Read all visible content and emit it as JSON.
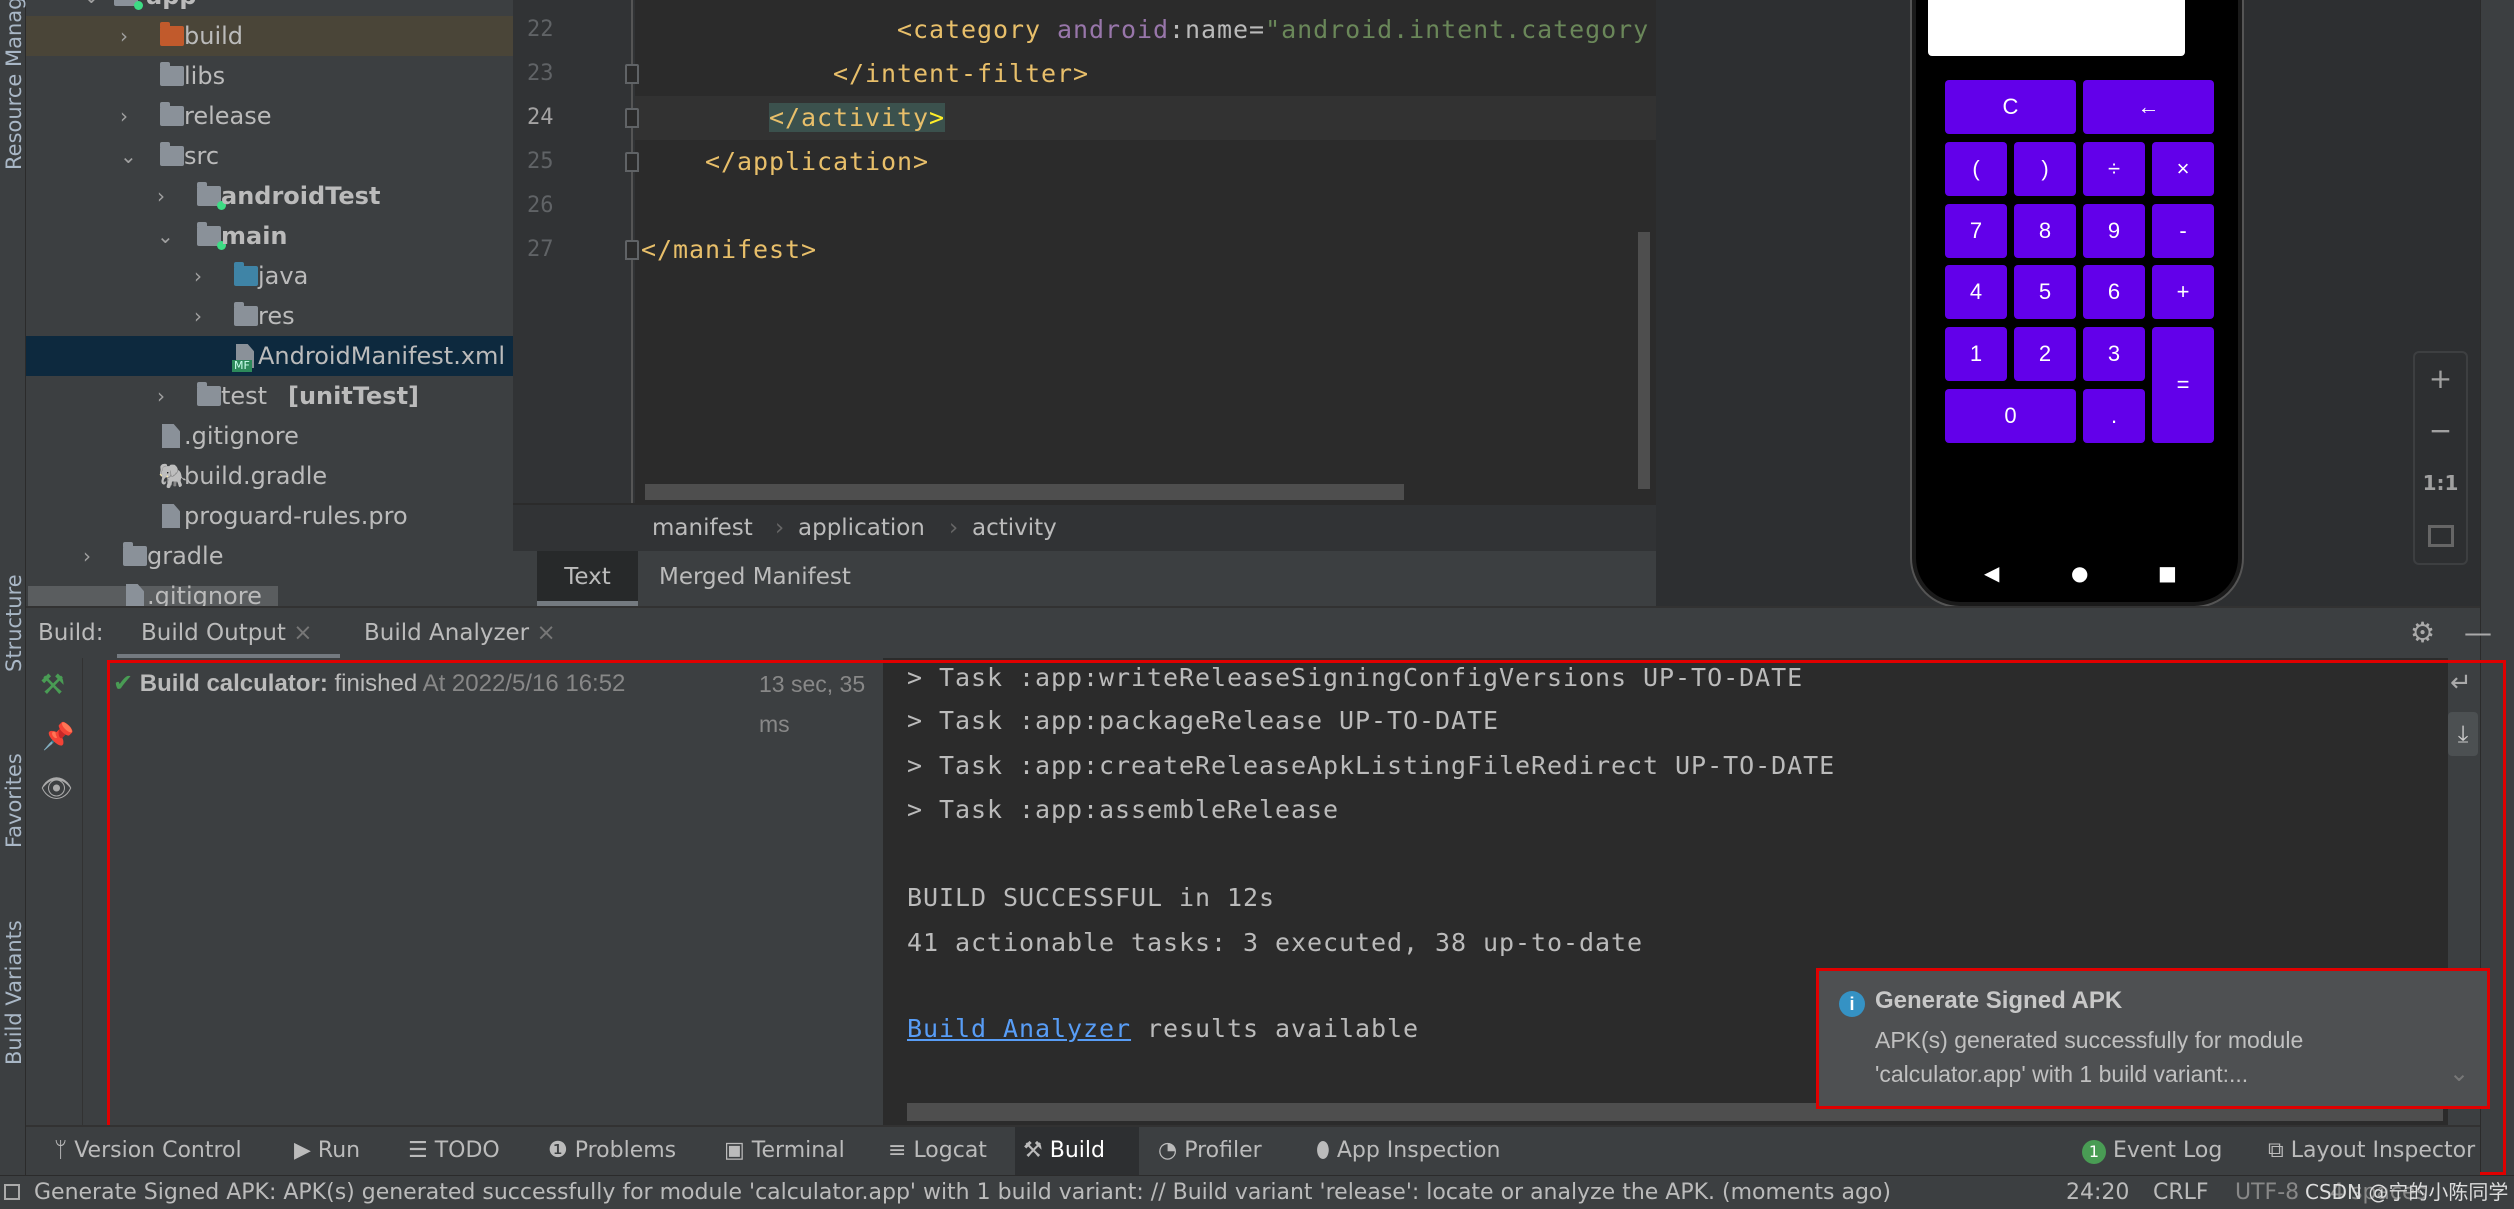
{
  "left_strip": {
    "resource_manager": "Resource Manager",
    "structure": "Structure",
    "favorites": "Favorites",
    "build_variants": "Build Variants"
  },
  "project_tree": {
    "items": [
      {
        "label": "app"
      },
      {
        "label": "build"
      },
      {
        "label": "libs"
      },
      {
        "label": "release"
      },
      {
        "label": "src"
      },
      {
        "label": "androidTest"
      },
      {
        "label": "main"
      },
      {
        "label": "java"
      },
      {
        "label": "res"
      },
      {
        "label": "AndroidManifest.xml",
        "badge": "MF"
      },
      {
        "label": "test",
        "suffix": "[unitTest]"
      },
      {
        "label": ".gitignore"
      },
      {
        "label": "build.gradle"
      },
      {
        "label": "proguard-rules.pro"
      },
      {
        "label": "gradle"
      },
      {
        "label": ".gitignore"
      }
    ]
  },
  "editor": {
    "line_numbers": [
      "22",
      "23",
      "24",
      "25",
      "26",
      "27"
    ],
    "current_line": "24",
    "lines": {
      "l22": {
        "tag": "<category",
        "ns": "android",
        "attr": ":name=",
        "value": "\"android.intent.category"
      },
      "l23": "</intent-filter>",
      "l24": {
        "open": "</activity",
        "close": ">"
      },
      "l25": "</application>",
      "l27": "</manifest>"
    },
    "breadcrumb": [
      "manifest",
      "application",
      "activity"
    ],
    "tabs": [
      {
        "label": "Text",
        "active": true
      },
      {
        "label": "Merged Manifest"
      }
    ]
  },
  "preview": {
    "keys": [
      "C",
      "←",
      "(",
      ")",
      "÷",
      "×",
      "7",
      "8",
      "9",
      "-",
      "4",
      "5",
      "6",
      "+",
      "1",
      "2",
      "3",
      "=",
      "0",
      "."
    ],
    "key_color": "#6200ea",
    "nav": [
      "◀",
      "●",
      "■"
    ],
    "zoom_controls": [
      "+",
      "−",
      "1:1",
      "fit-screen-icon"
    ]
  },
  "build": {
    "label": "Build:",
    "tabs": [
      {
        "label": "Build Output",
        "active": true
      },
      {
        "label": "Build Analyzer"
      }
    ],
    "result": {
      "title": "Build calculator:",
      "status": "finished",
      "time": "At 2022/5/16 16:52",
      "duration": "13 sec, 35 ms"
    },
    "console": [
      "> Task :app:writeReleaseSigningConfigVersions UP-TO-DATE",
      "> Task :app:packageRelease UP-TO-DATE",
      "> Task :app:createReleaseApkListingFileRedirect UP-TO-DATE",
      "> Task :app:assembleRelease",
      "BUILD SUCCESSFUL in 12s",
      "41 actionable tasks: 3 executed, 38 up-to-date"
    ],
    "analyzer_link": "Build Analyzer",
    "analyzer_suffix": " results available"
  },
  "notification": {
    "title": "Generate Signed APK",
    "line1": "APK(s) generated successfully for module",
    "line2": "'calculator.app' with 1 build variant:..."
  },
  "tool_windows": {
    "left": [
      "Version Control",
      "Run",
      "TODO",
      "Problems",
      "Terminal",
      "Logcat",
      "Build",
      "Profiler",
      "App Inspection"
    ],
    "active": "Build",
    "event_log": "Event Log",
    "event_log_count": "1",
    "layout_inspector": "Layout Inspector"
  },
  "status_bar": {
    "message": "Generate Signed APK: APK(s) generated successfully for module 'calculator.app' with 1 build variant: // Build variant 'release': locate or analyze the APK. (moments ago)",
    "position": "24:20",
    "line_sep": "CRLF",
    "encoding": "UTF-8",
    "indent": "4 spaces",
    "watermark": "CSDN @宁的小陈同学"
  },
  "colors": {
    "accent_red": "#e00000",
    "success": "#499c54",
    "link": "#589df6"
  }
}
